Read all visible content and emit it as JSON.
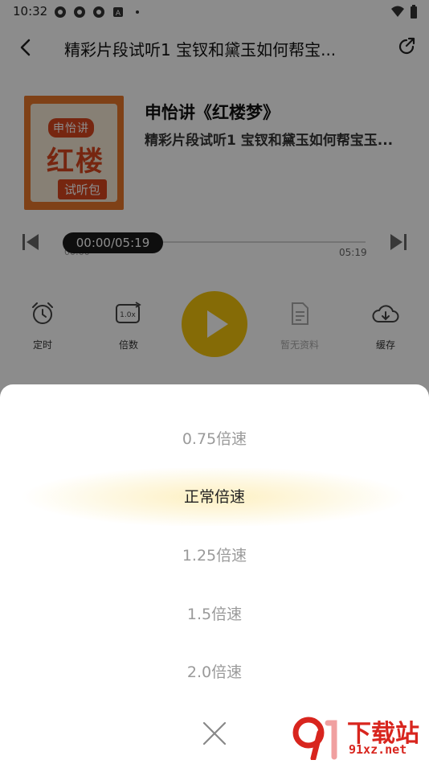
{
  "status_bar": {
    "time": "10:32"
  },
  "header": {
    "title": "精彩片段试听1 宝钗和黛玉如何帮宝..."
  },
  "album": {
    "name": "申怡讲《红楼梦》",
    "episode": "精彩片段试听1 宝钗和黛玉如何帮宝玉...",
    "cover_text_top": "申怡讲",
    "cover_text_main": "红楼",
    "cover_text_tag": "试听包"
  },
  "player": {
    "position_label": "00:00/05:19",
    "elapsed": "00:00",
    "duration": "05:19",
    "progress": 0.0
  },
  "controls": {
    "timer": "定时",
    "speed": "倍数",
    "speed_icon_text": "1.0x",
    "material": "暂无资料",
    "download": "缓存"
  },
  "speed_sheet": {
    "options": [
      "0.75倍速",
      "正常倍速",
      "1.25倍速",
      "1.5倍速",
      "2.0倍速"
    ],
    "selected_index": 1
  },
  "watermark": {
    "title": "下载站",
    "domain": "91xz.net"
  },
  "colors": {
    "accent": "#f2c40c",
    "selected_highlight": "#fdf0c2",
    "cover_orange": "#e8772a",
    "watermark_red": "#d8251e"
  }
}
